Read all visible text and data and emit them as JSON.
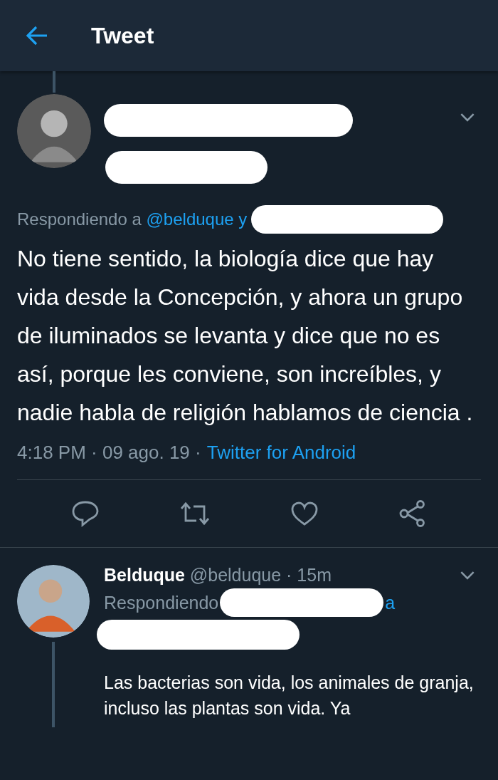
{
  "header": {
    "title": "Tweet"
  },
  "tweet": {
    "replying_prefix": "Respondiendo a",
    "replying_to": "@belduque y",
    "text": "No tiene sentido, la biología dice que hay vida desde la Concepción, y ahora un grupo de iluminados se levanta y dice que no es así, porque les conviene, son increíbles, y nadie habla de religión hablamos de ciencia .",
    "time": "4:18 PM · 09 ago. 19 ·",
    "source": "Twitter for Android"
  },
  "reply": {
    "name": "Belduque",
    "handle": "@belduque · 15m",
    "replying_prefix": "Respondiendo",
    "replying_tail": "a",
    "text": "Las bacterias son vida, los animales de granja, incluso las plantas son vida. Ya"
  }
}
